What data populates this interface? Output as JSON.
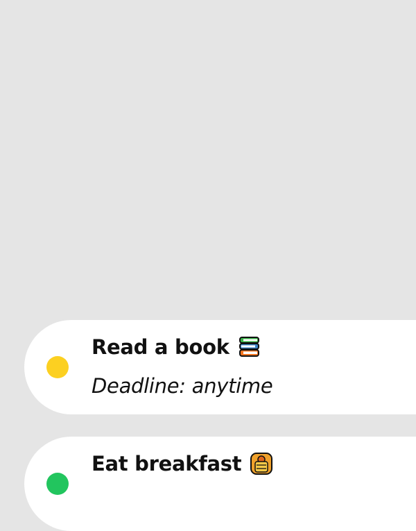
{
  "colors": {
    "background": "#e5e5e5",
    "card": "#ffffff",
    "status_yellow": "#fcd021",
    "status_green": "#22c55e"
  },
  "tasks": [
    {
      "title": "Read a book",
      "emoji_icon": "books-icon",
      "deadline": "Deadline: anytime",
      "status_color": "#fcd021"
    },
    {
      "title": "Eat breakfast",
      "emoji_icon": "pancakes-icon",
      "status_color": "#22c55e"
    }
  ]
}
